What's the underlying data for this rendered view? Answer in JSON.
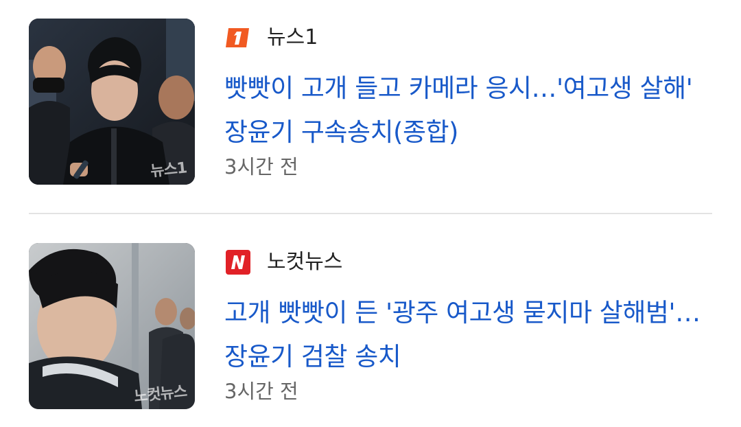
{
  "articles": [
    {
      "source": "뉴스1",
      "source_icon": "news1-logo-icon",
      "source_color": "#f15a22",
      "headline": "빳빳이 고개 들고 카메라 응시…'여고생 살해' 장윤기 구속송치(종합)",
      "time": "3시간 전",
      "thumbnail_watermark": "뉴스1"
    },
    {
      "source": "노컷뉴스",
      "source_icon": "nocut-logo-icon",
      "source_color": "#e12127",
      "headline": "고개 빳빳이 든 '광주 여고생 묻지마 살해범'…장윤기 검찰 송치",
      "time": "3시간 전",
      "thumbnail_watermark": "노컷뉴스"
    }
  ],
  "colors": {
    "headline": "#1859c9",
    "source_text": "#222222",
    "time_text": "#666666",
    "divider": "#e3e3e3"
  }
}
